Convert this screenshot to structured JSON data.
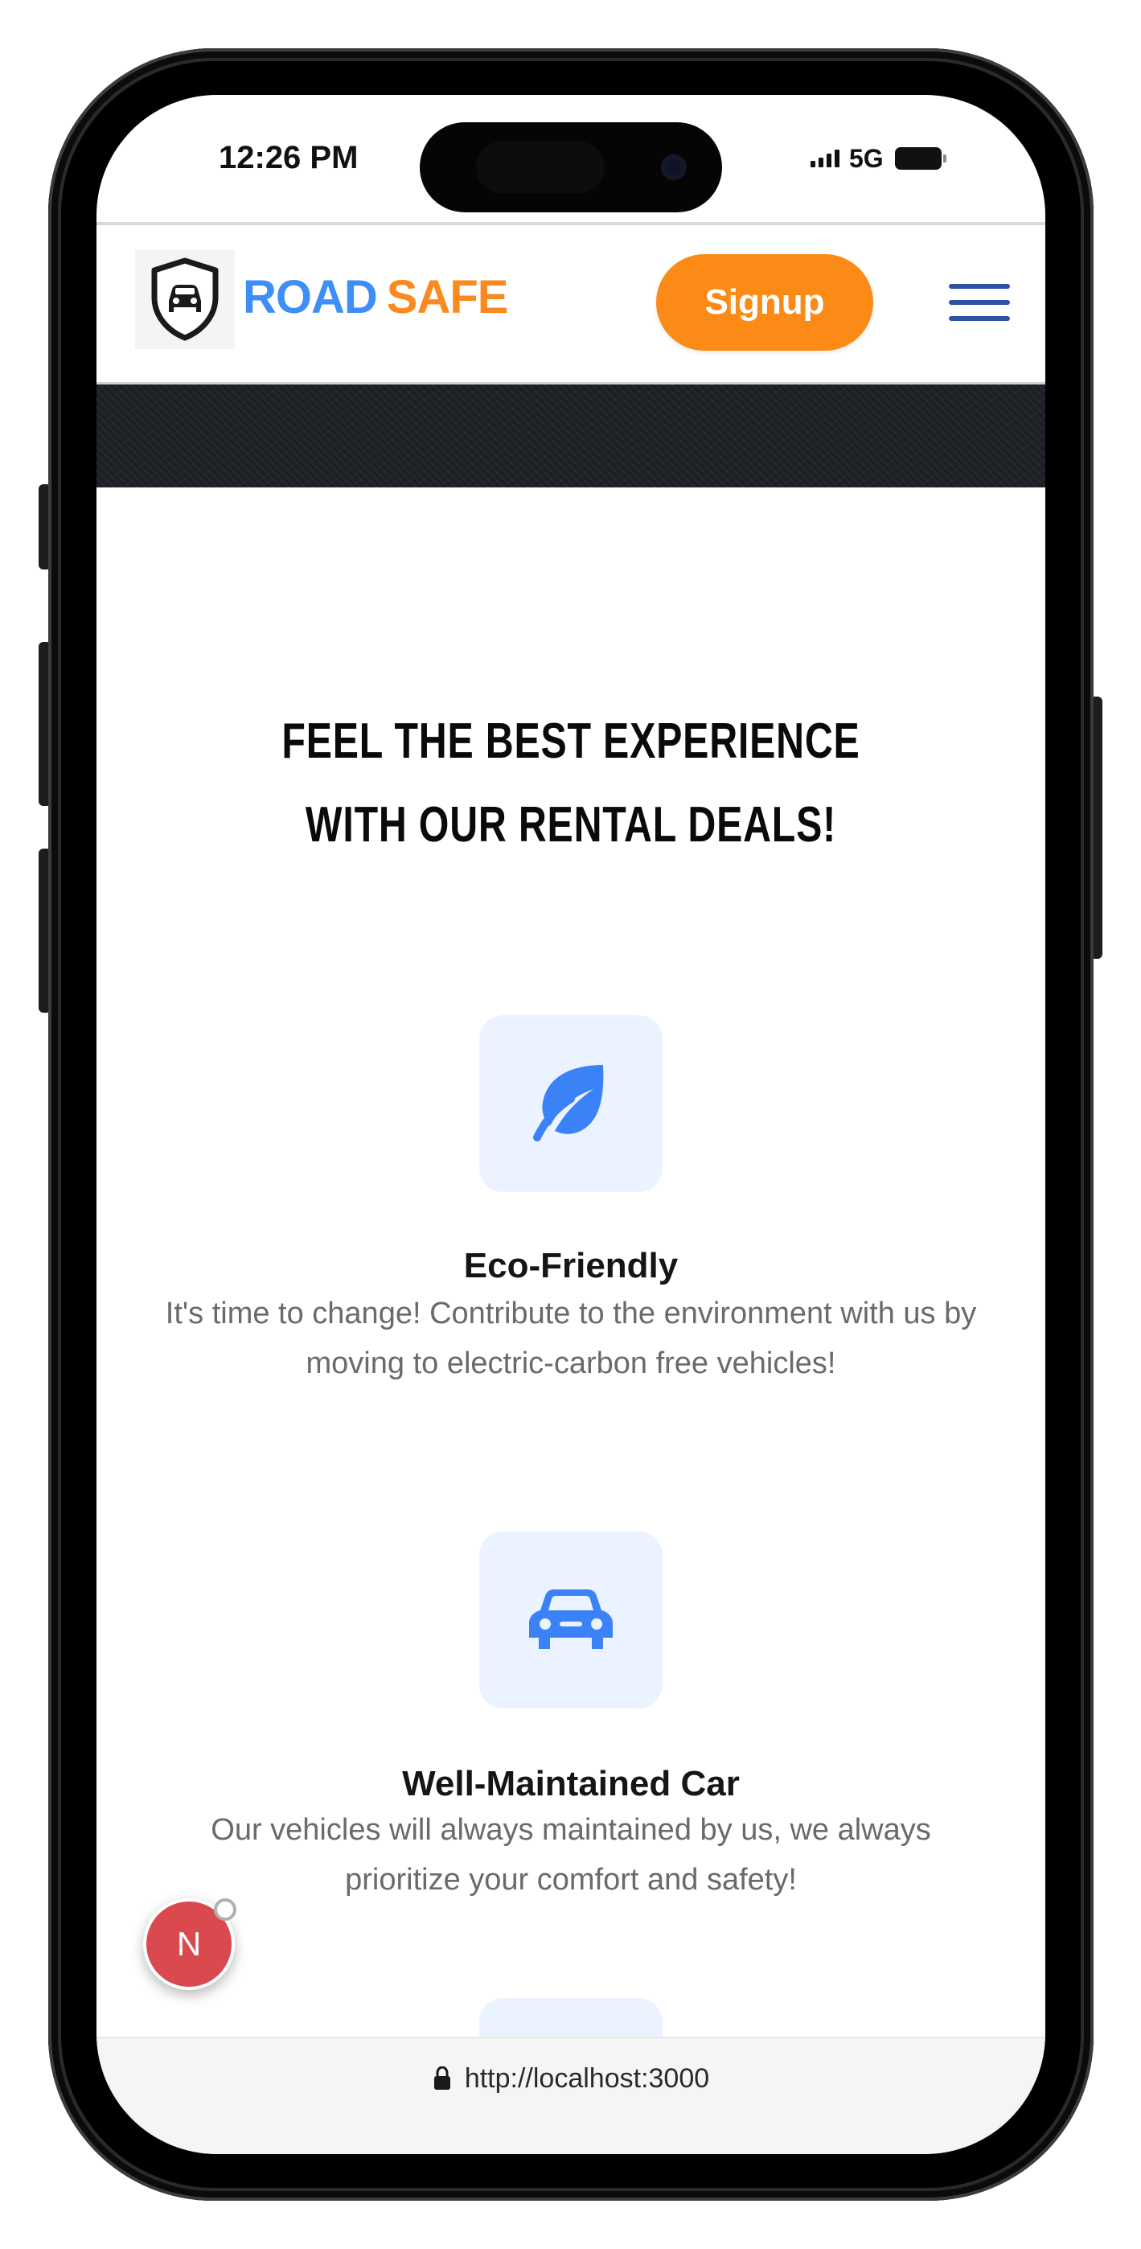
{
  "status_bar": {
    "time": "12:26 PM",
    "network": "5G",
    "icons": [
      "signal-bars-icon",
      "battery-icon"
    ]
  },
  "header": {
    "brand_first": "ROAD",
    "brand_second": "SAFE",
    "signup_label": "Signup",
    "icons": [
      "shield-car-logo-icon",
      "hamburger-menu-icon"
    ]
  },
  "section": {
    "title_line_1": "FEEL THE BEST EXPERIENCE",
    "title_line_2": "WITH OUR RENTAL DEALS!"
  },
  "features": [
    {
      "icon": "leaf-icon",
      "title": "Eco-Friendly",
      "description": "It's time to change! Contribute to the environment with us by moving to electric-carbon free vehicles!"
    },
    {
      "icon": "car-icon",
      "title": "Well-Maintained Car",
      "description": "Our vehicles will always maintained by us, we always prioritize your comfort and safety!"
    }
  ],
  "floating_badge": {
    "letter": "N"
  },
  "url_bar": {
    "url": "http://localhost:3000",
    "icon": "lock-icon"
  },
  "colors": {
    "brand_blue": "#3e8ef7",
    "brand_orange": "#f98a1f",
    "signup_orange": "#fb8b16",
    "menu_blue": "#2c53a5",
    "icon_tile_bg": "#eaf3ff",
    "icon_blue": "#3b82f6",
    "badge_red": "#d9494e",
    "hero_dark": "#1b1f24"
  }
}
